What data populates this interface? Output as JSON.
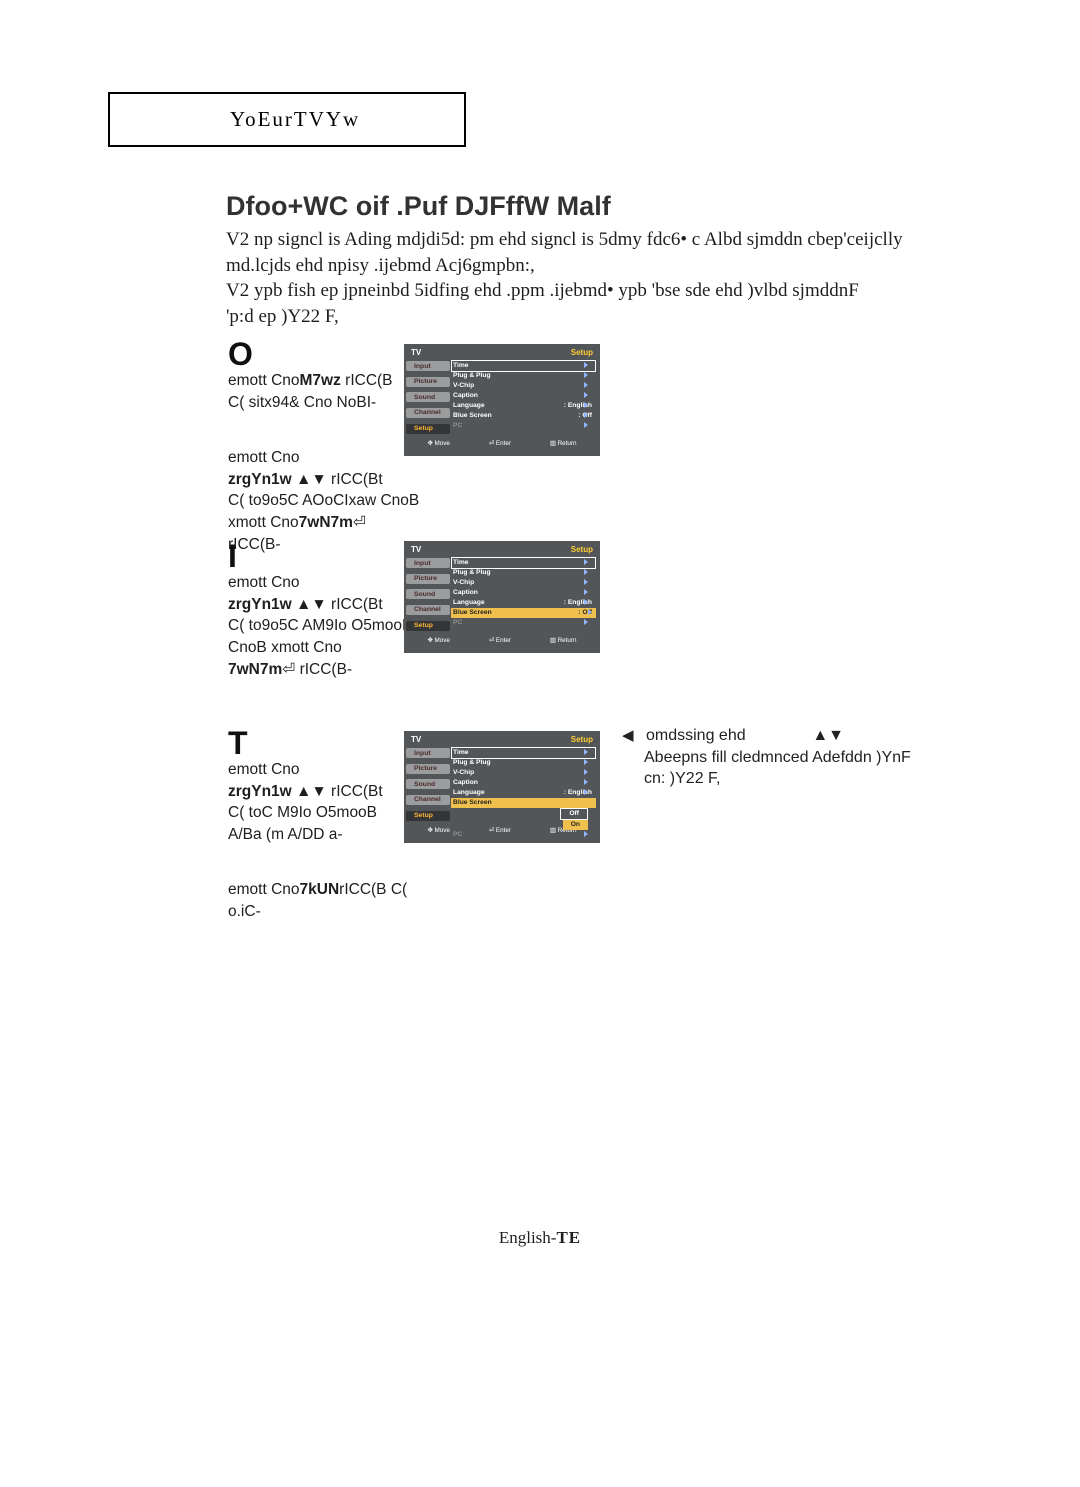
{
  "header": {
    "label": "YoEurTVYw"
  },
  "title": "Dfoo+WC oif .Puf DJFffW Malf",
  "body": "V2 np signcl is Ading mdjdi5d: pm ehd signcl is 5dmy fdc6• c Albd sjmddn cbep'ceijclly md.lcjds ehd npisy .ijebmd Acj6gmpbn:,\nV2 ypb fish ep jpneinbd 5idfing ehd .ppm .ijebmd• ypb 'bse sde ehd )vlbd sjmddnF\n'p:d ep )Y22 F,",
  "steps": [
    {
      "icon": "O",
      "lines": [
        "emott Cno<b>M7wz</b>  rICC(B",
        "C( sitx94& Cno NoBI-",
        "",
        "emott Cno",
        "<b>zrgYn1w  ▲▼</b> rICC(Bt",
        "C( to9o5C AOoCIxaw CnoB",
        "xmott Cno<b>7wN7m</b>⏎",
        "rICC(B-"
      ]
    },
    {
      "icon": "I",
      "lines": [
        "emott Cno",
        "<b>zrgYn1w  ▲▼</b> rICC(Bt",
        "C( to9o5C AM9Io O5mooBaw",
        "CnoB xmott Cno",
        "<b>7wN7m</b>⏎ rICC(B-"
      ]
    },
    {
      "icon": "T",
      "lines": [
        "emott Cno",
        "<b>zrgYn1w  ▲▼</b> rICC(Bt",
        "C( toC M9Io O5mooB",
        "A/Ba (m A/DD a-",
        "",
        "emott Cno<b>7kUN</b>rICC(B C(",
        "o.iC-"
      ]
    }
  ],
  "osd": {
    "tv": "TV",
    "setup": "Setup",
    "left": [
      "Input",
      "Picture",
      "Sound",
      "Channel",
      "Setup"
    ],
    "rows": [
      {
        "label": "Time",
        "arrow": true
      },
      {
        "label": "Plug & Plug",
        "arrow": true
      },
      {
        "label": "V-Chip",
        "arrow": true
      },
      {
        "label": "Caption",
        "arrow": true
      },
      {
        "label": "Language",
        "val": ":   English",
        "arrow": true
      },
      {
        "label": "Blue Screen",
        "val": ":   Off",
        "arrow": true
      },
      {
        "label": "PC",
        "pc": true,
        "arrow": true
      }
    ],
    "bottom": [
      "✥ Move",
      "⏎ Enter",
      "▥ Return"
    ]
  },
  "osd3_options": {
    "off": "Off",
    "on": "On"
  },
  "footnote": {
    "pre": "◀",
    "text1": "omdssing ehd",
    "arrows": "▲▼",
    "text2": "Abeepns fill cledmnced Adefddn )YnF cn: )Y22 F,"
  },
  "footer": {
    "left": "English-",
    "page": "TE"
  }
}
